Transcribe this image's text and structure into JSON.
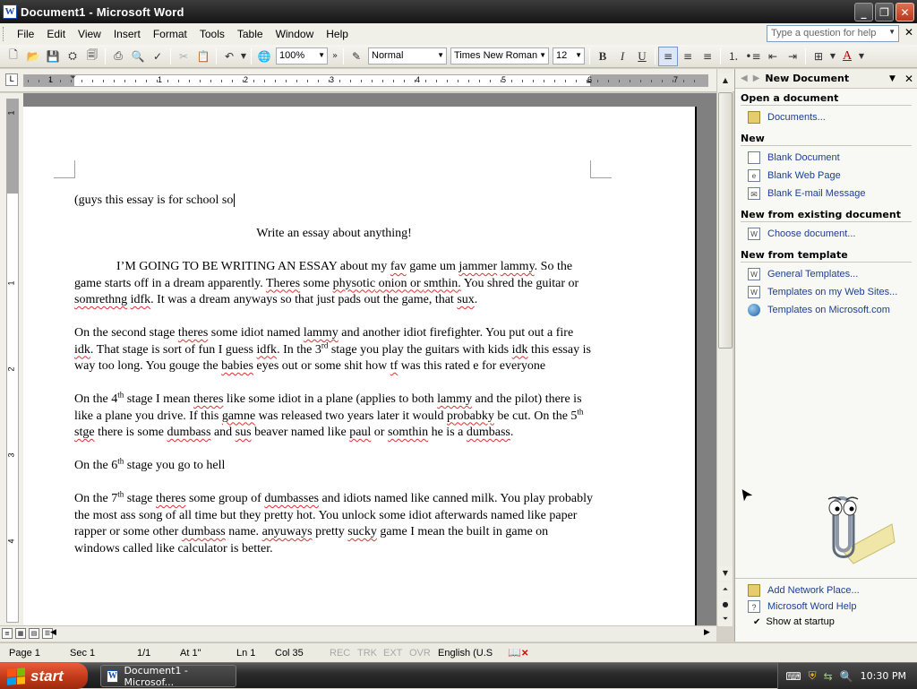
{
  "window": {
    "title": "Document1 - Microsoft Word",
    "app_icon": "word-icon",
    "buttons": [
      "minimize",
      "maximize",
      "close"
    ]
  },
  "menubar": {
    "items": [
      "File",
      "Edit",
      "View",
      "Insert",
      "Format",
      "Tools",
      "Table",
      "Window",
      "Help"
    ],
    "ask_placeholder": "Type a question for help"
  },
  "toolbar": {
    "zoom": "100%",
    "style": "Normal",
    "font": "Times New Roman",
    "size": "12",
    "bold": "B",
    "italic": "I",
    "underline": "U"
  },
  "ruler": {
    "numbers": [
      "1",
      "1",
      "2",
      "3",
      "4",
      "5",
      "6",
      "7"
    ],
    "vertical_numbers": [
      "1",
      "1",
      "2",
      "3",
      "4"
    ]
  },
  "document": {
    "line1": "(guys this essay is for  school so",
    "title": "Write an essay about anything!",
    "p1_a": "I’M GOING TO BE WRITING AN ESSAY about my ",
    "p1_fav": "fav",
    "p1_b": " game um ",
    "p1_jammer": "jammer",
    "p1_lammy": "lammy",
    "p1_c": ". So the game starts off in a dream apparently. ",
    "p1_theres": "Theres",
    "p1_d": " some ",
    "p1_physotic": "physotic",
    "p1_e": " onion or ",
    "p1_smthin": "smthin.",
    "p1_f": " You shred the guitar or ",
    "p1_somrethng": "somrethng",
    "p1_g": " ",
    "p1_idfk": "idfk",
    "p1_h": ". It was a dream anyways so that just pads out the game, that ",
    "p1_sux": "sux",
    "p1_i": ".",
    "p2_a": "On the second stage ",
    "p2_theres": "theres",
    "p2_b": " some idiot named ",
    "p2_lammy": "lammy",
    "p2_c": " and another idiot firefighter.  You put out a fire ",
    "p2_idk": "idk",
    "p2_d": ". That stage is sort of fun I guess ",
    "p2_idfk": "idfk",
    "p2_e": ". In the 3",
    "p2_rd": "rd",
    "p2_f": " stage you play the guitars with kids ",
    "p2_idk2": "idk",
    "p2_g": " this essay is way too long.  You gouge the ",
    "p2_babies": "babies",
    "p2_h": " eyes out or some shit how ",
    "p2_tf": "tf",
    "p2_i": " was this rated e for everyone",
    "p3_a": "On the 4",
    "p3_th": "th",
    "p3_b": " stage I mean ",
    "p3_theres": "theres",
    "p3_c": " like some idiot in a plane (applies to both ",
    "p3_lammy": "lammy",
    "p3_d": " and the pilot) there is like a plane you drive. If this ",
    "p3_gamne": "gamne",
    "p3_e": " was released two years later it would ",
    "p3_probabky": "probabky",
    "p3_f": " be cut. On the 5",
    "p3_th2": "th",
    "p3_g": " ",
    "p3_stge": "stge",
    "p3_h": " there is some ",
    "p3_dumbass": "dumbass",
    "p3_i": " and ",
    "p3_sus": "sus",
    "p3_j": " beaver named like ",
    "p3_paul": "paul",
    "p3_k": " or ",
    "p3_somthin": "somthin",
    "p3_l": " he is a ",
    "p3_dumbass2": "dumbass",
    "p3_m": ".",
    "p4_a": "On the 6",
    "p4_th": "th",
    "p4_b": " stage you go to hell",
    "p5_a": "On the 7",
    "p5_th": "th",
    "p5_b": " stage ",
    "p5_theres": "theres",
    "p5_c": " some group of ",
    "p5_dumbasses": "dumbasses",
    "p5_d": " and idiots named like canned milk.  You play probably the most ass song of all time but they pretty hot. You unlock some idiot afterwards named like paper rapper or some other ",
    "p5_dumbass": "dumbass",
    "p5_e": " name. ",
    "p5_anyuways": "anyuways",
    "p5_f": " pretty ",
    "p5_sucky": "sucky",
    "p5_g": " game I mean the built in game on windows called like calculator is better."
  },
  "taskpane": {
    "title": "New Document",
    "open_heading": "Open a document",
    "open_items": [
      "Documents..."
    ],
    "new_heading": "New",
    "new_items": [
      "Blank Document",
      "Blank Web Page",
      "Blank E-mail Message"
    ],
    "existing_heading": "New from existing document",
    "existing_items": [
      "Choose document..."
    ],
    "template_heading": "New from template",
    "template_items": [
      "General Templates...",
      "Templates on my Web Sites...",
      "Templates on Microsoft.com"
    ],
    "bottom_items": [
      "Add Network Place...",
      "Microsoft Word Help"
    ],
    "show_at_startup": "Show at startup"
  },
  "statusbar": {
    "page": "Page 1",
    "sec": "Sec 1",
    "pages": "1/1",
    "at": "At 1\"",
    "ln": "Ln 1",
    "col": "Col 35",
    "rec": "REC",
    "trk": "TRK",
    "ext": "EXT",
    "ovr": "OVR",
    "lang": "English (U.S"
  },
  "taskbar": {
    "start": "start",
    "item": "Document1 - Microsof...",
    "clock": "10:30 PM"
  },
  "colors": {
    "squiggle": "#e03030",
    "link": "#1c3f94",
    "start": "#c23a18"
  }
}
